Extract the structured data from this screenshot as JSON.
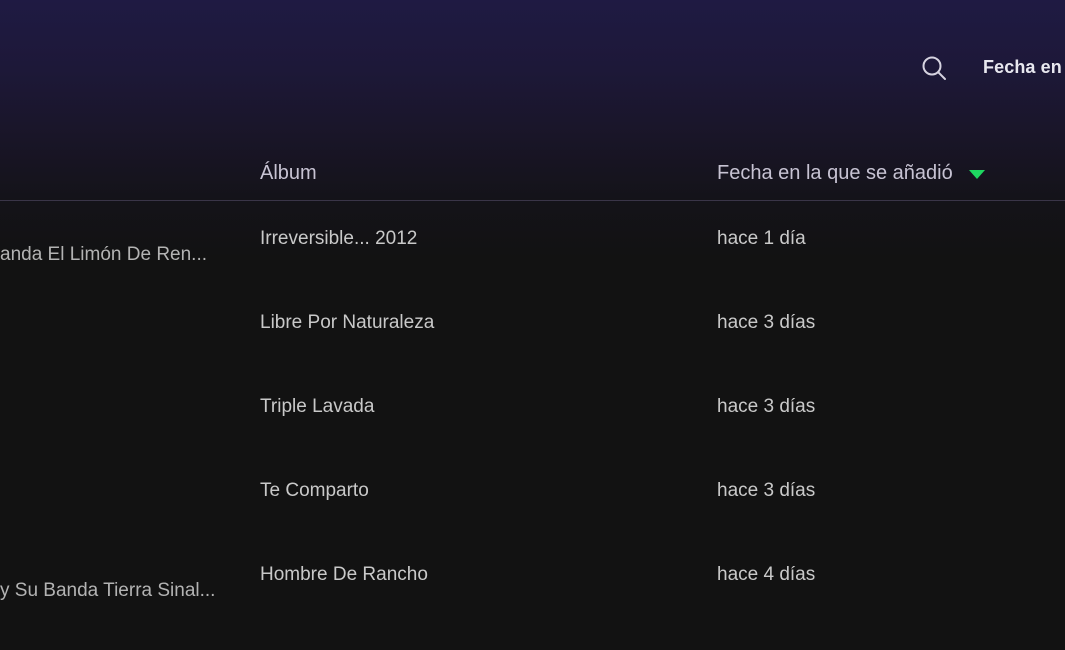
{
  "toolbar": {
    "search_icon": "search-icon",
    "sort_label": "Fecha en"
  },
  "table": {
    "headers": {
      "album": "Álbum",
      "date_added": "Fecha en la que se añadió"
    },
    "sort_indicator_color": "#1ed760",
    "rows": [
      {
        "artist": "anda El Limón De Ren...",
        "album": "Irreversible... 2012",
        "date_added": "hace 1 día"
      },
      {
        "artist": "",
        "album": "Libre Por Naturaleza",
        "date_added": "hace 3 días"
      },
      {
        "artist": "",
        "album": "Triple Lavada",
        "date_added": "hace 3 días"
      },
      {
        "artist": "",
        "album": "Te Comparto",
        "date_added": "hace 3 días"
      },
      {
        "artist": "y Su Banda Tierra Sinal...",
        "album": "Hombre De Rancho",
        "date_added": "hace 4 días"
      }
    ]
  }
}
